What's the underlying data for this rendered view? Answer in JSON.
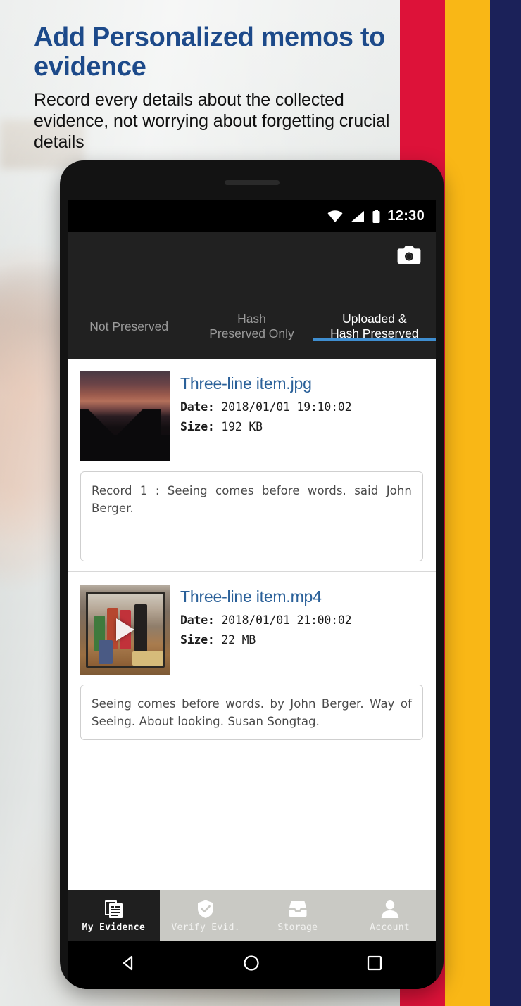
{
  "palette": {
    "headline_blue": "#1d4a8a",
    "bar_red": "#dd1239",
    "bar_yellow": "#f9b716",
    "bar_navy": "#1b2159",
    "tab_indicator_blue": "#3f8ed0",
    "link_blue": "#2a6099",
    "appbar_dark": "#212121",
    "nav_active_dark": "#1f1f1f",
    "nav_inactive_gray": "#c9c9c4"
  },
  "headline": {
    "title": "Add Personalized memos to evidence",
    "subtitle": "Record every details about the collected evidence, not worrying about forgetting crucial details"
  },
  "phone": {
    "status_bar": {
      "time": "12:30",
      "icons": [
        "wifi-icon",
        "cellular-signal-icon",
        "battery-icon"
      ]
    },
    "app_bar": {
      "camera_button_icon": "camera-icon",
      "tabs": [
        {
          "label": "Not Preserved",
          "active": false
        },
        {
          "label": "Hash\nPreserved Only",
          "line1": "Hash",
          "line2": "Preserved Only",
          "active": false
        },
        {
          "label": "Uploaded &\nHash Preserved",
          "line1": "Uploaded &",
          "line2": "Hash Preserved",
          "active": true
        }
      ]
    },
    "evidence_items": [
      {
        "filename": "Three-line item.jpg",
        "date_label": "Date:",
        "date_value": "2018/01/01  19:10:02",
        "size_label": "Size:",
        "size_value": "192 KB",
        "thumbnail": "sunset-house-photo-thumbnail",
        "memo": "Record 1 : Seeing comes before words. said John Berger."
      },
      {
        "filename": "Three-line item.mp4",
        "date_label": "Date:",
        "date_value": "2018/01/01 21:00:02",
        "size_label": "Size:",
        "size_value": "22 MB",
        "thumbnail": "video-scene-thumbnail",
        "play_icon": "play-triangle-icon",
        "memo": "Seeing comes before words. by John Berger. Way of Seeing. About looking. Susan Songtag."
      }
    ],
    "bottom_nav": [
      {
        "label": "My Evidence",
        "icon": "documents-stack-icon",
        "active": true
      },
      {
        "label": "Verify Evid.",
        "icon": "shield-check-icon",
        "active": false
      },
      {
        "label": "Storage",
        "icon": "inbox-tray-icon",
        "active": false
      },
      {
        "label": "Account",
        "icon": "person-icon",
        "active": false
      }
    ],
    "android_nav": [
      {
        "name": "back-button",
        "icon": "triangle-back-icon"
      },
      {
        "name": "home-button",
        "icon": "circle-home-icon"
      },
      {
        "name": "recents-button",
        "icon": "square-recents-icon"
      }
    ]
  }
}
